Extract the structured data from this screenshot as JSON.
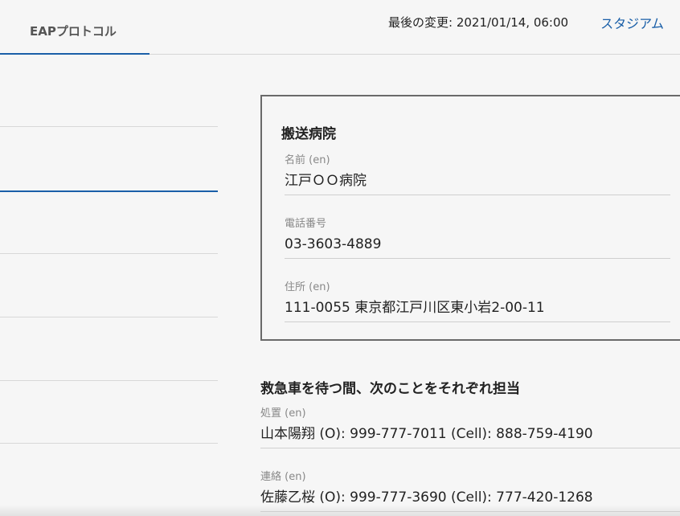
{
  "header": {
    "tab_label": "EAPプロトコル",
    "last_modified": "最後の変更: 2021/01/14, 06:00",
    "stadium_link": "スタジアム"
  },
  "colors": {
    "accent": "#1a5fa8",
    "card_border": "#6a6a6a",
    "background": "#f6f6f6"
  },
  "hospital": {
    "title": "搬送病院",
    "name_label": "名前 (en)",
    "name_value": "江戸ＯＯ病院",
    "phone_label": "電話番号",
    "phone_value": "03-3603-4889",
    "address_label": "住所 (en)",
    "address_value": "111-0055 東京都江戸川区東小岩2-00-11"
  },
  "responsibilities": {
    "title": "救急車を待つ間、次のことをそれぞれ担当",
    "items": [
      {
        "label": "処置 (en)",
        "value": "山本陽翔 (O): 999-777-7011 (Cell): 888-759-4190"
      },
      {
        "label": "連絡 (en)",
        "value": "佐藤乙桜 (O): 999-777-3690 (Cell): 777-420-1268"
      }
    ]
  }
}
